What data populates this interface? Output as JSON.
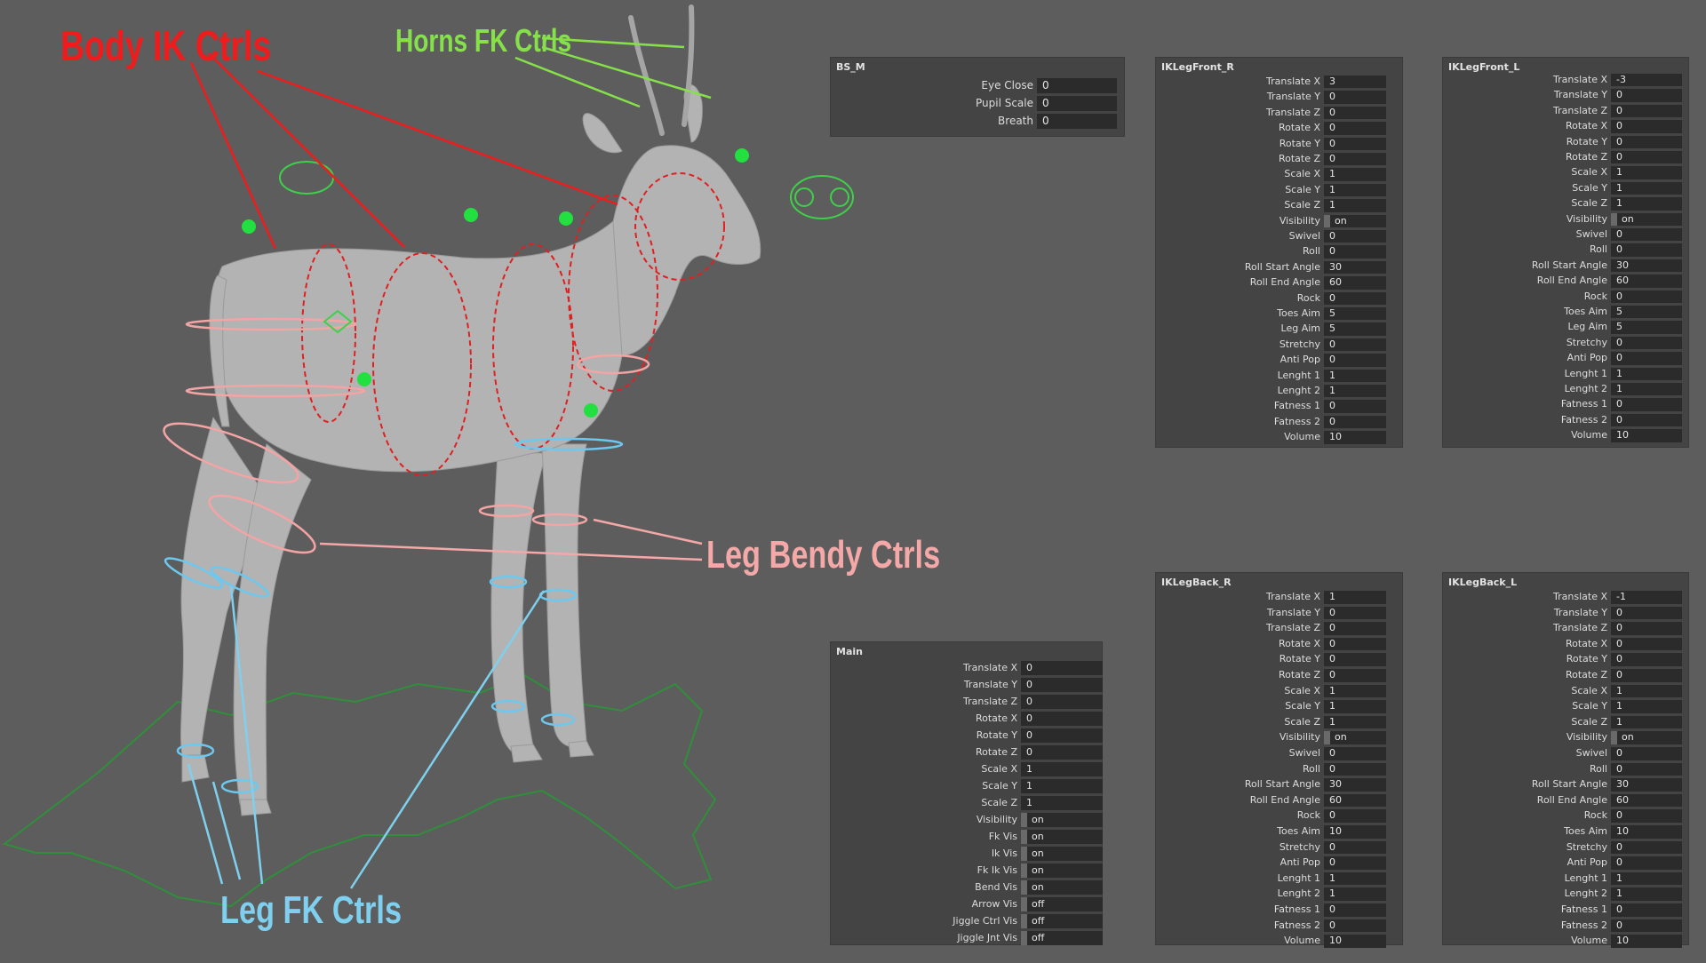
{
  "callouts": {
    "body_ik": "Body IK Ctrls",
    "horns_fk": "Horns FK Ctrls",
    "leg_bendy": "Leg Bendy Ctrls",
    "leg_fk": "Leg FK Ctrls"
  },
  "colors": {
    "body_ik": "#ee1c1c",
    "horns_fk": "#86e04a",
    "leg_bendy": "#f4a8a8",
    "leg_fk": "#7fd0ef",
    "background": "#5d5d5d",
    "panel": "#444444",
    "field": "#2b2b2b"
  },
  "panels": {
    "bs_m": {
      "title": "BS_M",
      "rows": [
        {
          "label": "Eye Close",
          "value": "0"
        },
        {
          "label": "Pupil Scale",
          "value": "0"
        },
        {
          "label": "Breath",
          "value": "0"
        }
      ]
    },
    "main": {
      "title": "Main",
      "rows": [
        {
          "label": "Translate X",
          "value": "0"
        },
        {
          "label": "Translate Y",
          "value": "0"
        },
        {
          "label": "Translate Z",
          "value": "0"
        },
        {
          "label": "Rotate X",
          "value": "0"
        },
        {
          "label": "Rotate Y",
          "value": "0"
        },
        {
          "label": "Rotate Z",
          "value": "0"
        },
        {
          "label": "Scale X",
          "value": "1"
        },
        {
          "label": "Scale Y",
          "value": "1"
        },
        {
          "label": "Scale Z",
          "value": "1"
        },
        {
          "label": "Visibility",
          "value": "on"
        },
        {
          "label": "Fk Vis",
          "value": "on"
        },
        {
          "label": "Ik Vis",
          "value": "on"
        },
        {
          "label": "Fk Ik Vis",
          "value": "on"
        },
        {
          "label": "Bend Vis",
          "value": "on"
        },
        {
          "label": "Arrow Vis",
          "value": "off"
        },
        {
          "label": "Jiggle Ctrl Vis",
          "value": "off"
        },
        {
          "label": "Jiggle Jnt Vis",
          "value": "off"
        }
      ]
    },
    "ik_front_r": {
      "title": "IKLegFront_R",
      "rows": [
        {
          "label": "Translate X",
          "value": "3"
        },
        {
          "label": "Translate Y",
          "value": "0"
        },
        {
          "label": "Translate Z",
          "value": "0"
        },
        {
          "label": "Rotate X",
          "value": "0"
        },
        {
          "label": "Rotate Y",
          "value": "0"
        },
        {
          "label": "Rotate Z",
          "value": "0"
        },
        {
          "label": "Scale X",
          "value": "1"
        },
        {
          "label": "Scale Y",
          "value": "1"
        },
        {
          "label": "Scale Z",
          "value": "1"
        },
        {
          "label": "Visibility",
          "value": "on"
        },
        {
          "label": "Swivel",
          "value": "0"
        },
        {
          "label": "Roll",
          "value": "0"
        },
        {
          "label": "Roll Start Angle",
          "value": "30"
        },
        {
          "label": "Roll End Angle",
          "value": "60"
        },
        {
          "label": "Rock",
          "value": "0"
        },
        {
          "label": "Toes Aim",
          "value": "5"
        },
        {
          "label": "Leg Aim",
          "value": "5"
        },
        {
          "label": "Stretchy",
          "value": "0"
        },
        {
          "label": "Anti Pop",
          "value": "0"
        },
        {
          "label": "Lenght 1",
          "value": "1"
        },
        {
          "label": "Lenght 2",
          "value": "1"
        },
        {
          "label": "Fatness 1",
          "value": "0"
        },
        {
          "label": "Fatness 2",
          "value": "0"
        },
        {
          "label": "Volume",
          "value": "10"
        }
      ]
    },
    "ik_front_l": {
      "title": "IKLegFront_L",
      "rows": [
        {
          "label": "Translate X",
          "value": "-3"
        },
        {
          "label": "Translate Y",
          "value": "0"
        },
        {
          "label": "Translate Z",
          "value": "0"
        },
        {
          "label": "Rotate X",
          "value": "0"
        },
        {
          "label": "Rotate Y",
          "value": "0"
        },
        {
          "label": "Rotate Z",
          "value": "0"
        },
        {
          "label": "Scale X",
          "value": "1"
        },
        {
          "label": "Scale Y",
          "value": "1"
        },
        {
          "label": "Scale Z",
          "value": "1"
        },
        {
          "label": "Visibility",
          "value": "on"
        },
        {
          "label": "Swivel",
          "value": "0"
        },
        {
          "label": "Roll",
          "value": "0"
        },
        {
          "label": "Roll Start Angle",
          "value": "30"
        },
        {
          "label": "Roll End Angle",
          "value": "60"
        },
        {
          "label": "Rock",
          "value": "0"
        },
        {
          "label": "Toes Aim",
          "value": "5"
        },
        {
          "label": "Leg Aim",
          "value": "5"
        },
        {
          "label": "Stretchy",
          "value": "0"
        },
        {
          "label": "Anti Pop",
          "value": "0"
        },
        {
          "label": "Lenght 1",
          "value": "1"
        },
        {
          "label": "Lenght 2",
          "value": "1"
        },
        {
          "label": "Fatness 1",
          "value": "0"
        },
        {
          "label": "Fatness 2",
          "value": "0"
        },
        {
          "label": "Volume",
          "value": "10"
        }
      ]
    },
    "ik_back_r": {
      "title": "IKLegBack_R",
      "rows": [
        {
          "label": "Translate X",
          "value": "1"
        },
        {
          "label": "Translate Y",
          "value": "0"
        },
        {
          "label": "Translate Z",
          "value": "0"
        },
        {
          "label": "Rotate X",
          "value": "0"
        },
        {
          "label": "Rotate Y",
          "value": "0"
        },
        {
          "label": "Rotate Z",
          "value": "0"
        },
        {
          "label": "Scale X",
          "value": "1"
        },
        {
          "label": "Scale Y",
          "value": "1"
        },
        {
          "label": "Scale Z",
          "value": "1"
        },
        {
          "label": "Visibility",
          "value": "on"
        },
        {
          "label": "Swivel",
          "value": "0"
        },
        {
          "label": "Roll",
          "value": "0"
        },
        {
          "label": "Roll Start Angle",
          "value": "30"
        },
        {
          "label": "Roll End Angle",
          "value": "60"
        },
        {
          "label": "Rock",
          "value": "0"
        },
        {
          "label": "Toes Aim",
          "value": "10"
        },
        {
          "label": "Stretchy",
          "value": "0"
        },
        {
          "label": "Anti Pop",
          "value": "0"
        },
        {
          "label": "Lenght 1",
          "value": "1"
        },
        {
          "label": "Lenght 2",
          "value": "1"
        },
        {
          "label": "Fatness 1",
          "value": "0"
        },
        {
          "label": "Fatness 2",
          "value": "0"
        },
        {
          "label": "Volume",
          "value": "10"
        }
      ]
    },
    "ik_back_l": {
      "title": "IKLegBack_L",
      "rows": [
        {
          "label": "Translate X",
          "value": "-1"
        },
        {
          "label": "Translate Y",
          "value": "0"
        },
        {
          "label": "Translate Z",
          "value": "0"
        },
        {
          "label": "Rotate X",
          "value": "0"
        },
        {
          "label": "Rotate Y",
          "value": "0"
        },
        {
          "label": "Rotate Z",
          "value": "0"
        },
        {
          "label": "Scale X",
          "value": "1"
        },
        {
          "label": "Scale Y",
          "value": "1"
        },
        {
          "label": "Scale Z",
          "value": "1"
        },
        {
          "label": "Visibility",
          "value": "on"
        },
        {
          "label": "Swivel",
          "value": "0"
        },
        {
          "label": "Roll",
          "value": "0"
        },
        {
          "label": "Roll Start Angle",
          "value": "30"
        },
        {
          "label": "Roll End Angle",
          "value": "60"
        },
        {
          "label": "Rock",
          "value": "0"
        },
        {
          "label": "Toes Aim",
          "value": "10"
        },
        {
          "label": "Stretchy",
          "value": "0"
        },
        {
          "label": "Anti Pop",
          "value": "0"
        },
        {
          "label": "Lenght 1",
          "value": "1"
        },
        {
          "label": "Lenght 2",
          "value": "1"
        },
        {
          "label": "Fatness 1",
          "value": "0"
        },
        {
          "label": "Fatness 2",
          "value": "0"
        },
        {
          "label": "Volume",
          "value": "10"
        }
      ]
    }
  }
}
